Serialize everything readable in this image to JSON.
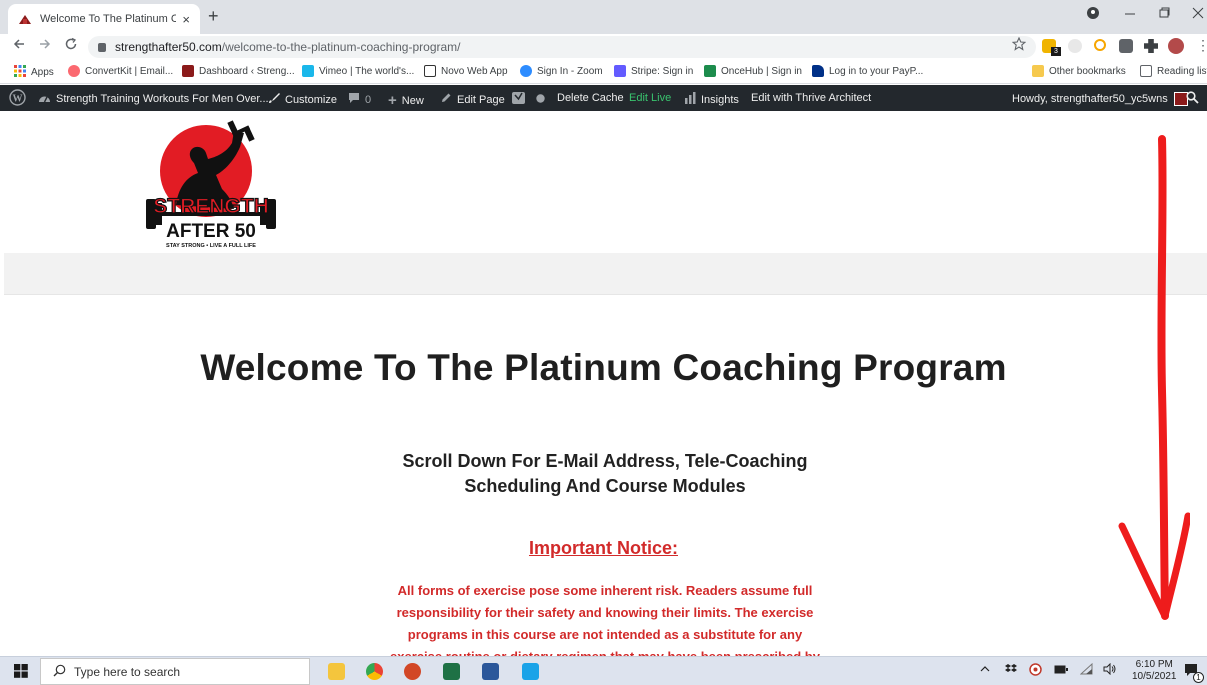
{
  "browser": {
    "tab_title": "Welcome To The Platinum Coach",
    "tab_close": "×",
    "new_tab": "+",
    "url_domain": "strengthafter50.com",
    "url_path": "/welcome-to-the-platinum-coaching-program/",
    "extension_badge": "3"
  },
  "bookmarks": {
    "items": [
      {
        "label": "Apps",
        "color": "#e8453c"
      },
      {
        "label": "ConvertKit | Email...",
        "color": "#fb6970"
      },
      {
        "label": "Dashboard ‹ Streng...",
        "color": "#8b1a1a"
      },
      {
        "label": "Vimeo | The world's...",
        "color": "#1ab7ea"
      },
      {
        "label": "Novo Web App",
        "color": "#333333"
      },
      {
        "label": "Sign In - Zoom",
        "color": "#2d8cff"
      },
      {
        "label": "Stripe: Sign in",
        "color": "#635bff"
      },
      {
        "label": "OnceHub | Sign in",
        "color": "#1c8c4c"
      },
      {
        "label": "Log in to your PayP...",
        "color": "#003087"
      }
    ],
    "other": "Other bookmarks",
    "reading": "Reading list"
  },
  "wpbar": {
    "site": "Strength Training Workouts For Men Over...",
    "customize": "Customize",
    "comments": "0",
    "new": "New",
    "edit_page": "Edit Page",
    "delete_cache": "Delete Cache",
    "edit_live": "Edit Live",
    "insights": "Insights",
    "thrive": "Edit with Thrive Architect",
    "howdy": "Howdy, strengthafter50_yc5wns"
  },
  "logo": {
    "word1": "STRENGTH",
    "word2": "AFTER 50",
    "tagline": "STAY STRONG • LIVE A FULL LIFE"
  },
  "page": {
    "heading": "Welcome To The Platinum Coaching Program",
    "sub_line1": "Scroll Down For E-Mail Address, Tele-Coaching",
    "sub_line2": "Scheduling And Course Modules",
    "notice_title": "Important Notice:",
    "notice_body": "All forms of exercise pose some inherent risk. Readers assume full responsibility for their safety and knowing their limits. The exercise programs in this course are not intended as a substitute for any exercise routine or dietary regimen that may have been prescribed by"
  },
  "taskbar": {
    "search_placeholder": "Type here to search",
    "time": "6:10 PM",
    "date": "10/5/2021",
    "notification_count": "1"
  },
  "colors": {
    "accent_red": "#d22a2a",
    "wp_bar": "#23282d",
    "edit_live_green": "#39c36e"
  }
}
